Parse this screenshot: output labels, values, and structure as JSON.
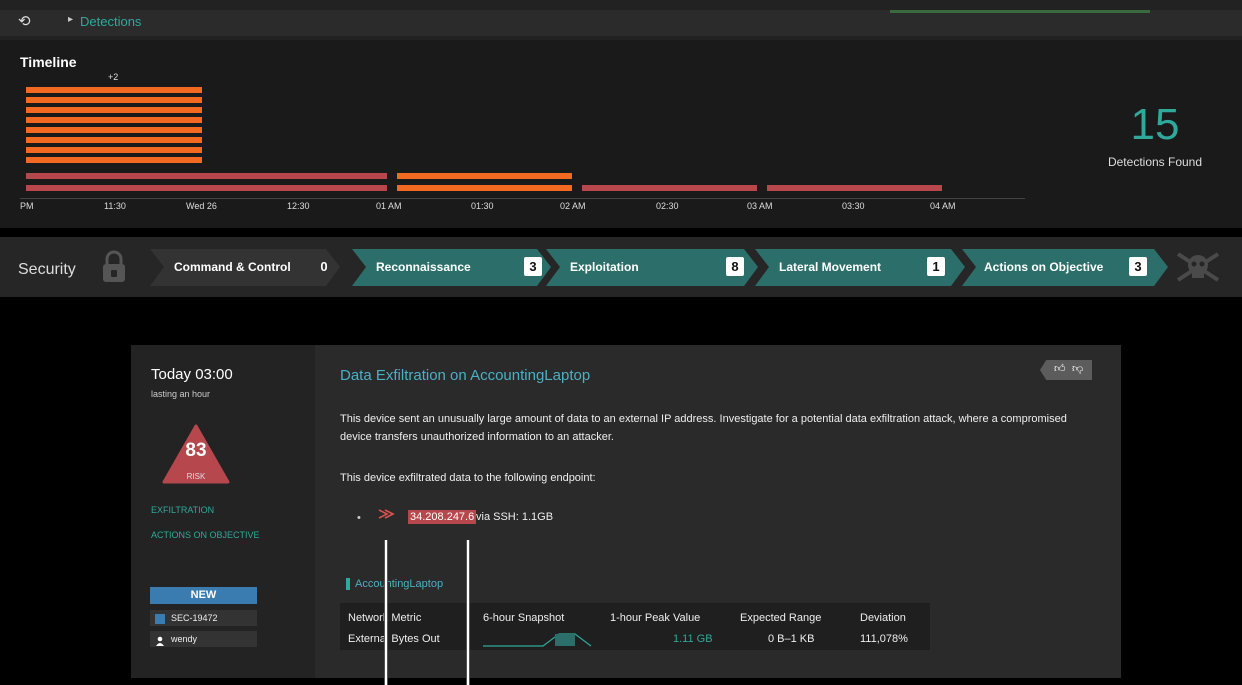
{
  "topbar": {
    "breadcrumb": "Detections",
    "back_icon": "history-icon"
  },
  "timeline": {
    "title": "Timeline",
    "overflow_note": "+2",
    "ticks": [
      "PM",
      "11:30",
      "Wed 26",
      "12:30",
      "01 AM",
      "01:30",
      "02 AM",
      "02:30",
      "03 AM",
      "03:30",
      "04 AM"
    ],
    "detections_count": "15",
    "detections_label": "Detections Found"
  },
  "security": {
    "label": "Security",
    "stages": [
      {
        "name": "Command & Control",
        "count": "0",
        "active": false
      },
      {
        "name": "Reconnaissance",
        "count": "3",
        "active": true
      },
      {
        "name": "Exploitation",
        "count": "8",
        "active": true
      },
      {
        "name": "Lateral Movement",
        "count": "1",
        "active": true
      },
      {
        "name": "Actions on Objective",
        "count": "3",
        "active": true
      }
    ]
  },
  "detection": {
    "time": "Today 03:00",
    "duration": "lasting an hour",
    "risk_score": "83",
    "risk_label": "RISK",
    "categories": [
      "EXFILTRATION",
      "ACTIONS ON OBJECTIVE"
    ],
    "status": "NEW",
    "ticket": "SEC-19472",
    "assignee": "wendy",
    "title": "Data Exfiltration on AccountingLaptop",
    "description": "This device sent an unusually large amount of data to an external IP address. Investigate for a potential data exfiltration attack, where a compromised device transfers unauthorized information to an attacker.",
    "endpoint_intro": "This device exfiltrated data to the following endpoint:",
    "endpoint_ip": "34.208.247.6",
    "endpoint_detail": "via SSH: 1.1GB",
    "device": "AccountingLaptop",
    "metrics": {
      "headers": [
        "Network Metric",
        "6-hour Snapshot",
        "1-hour Peak Value",
        "Expected Range",
        "Deviation"
      ],
      "row": {
        "metric": "External Bytes Out",
        "peak": "1.11 GB",
        "range": "0 B–1 KB",
        "deviation": "111,078%"
      }
    }
  },
  "colors": {
    "accent": "#2ea99b",
    "orange": "#f26a21",
    "red": "#b8474b",
    "teal_stage": "#2c6f6a"
  }
}
